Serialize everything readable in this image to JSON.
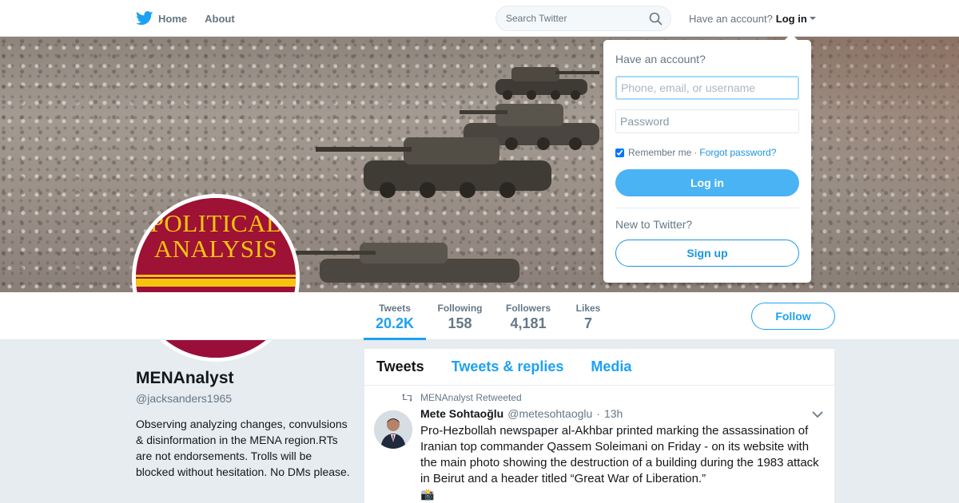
{
  "nav": {
    "home_label": "Home",
    "about_label": "About",
    "search_placeholder": "Search Twitter",
    "have_account": "Have an account?",
    "login_label": "Log in"
  },
  "icons": {
    "logo": "twitter-bird-icon",
    "search": "search-icon",
    "caret": "caret-down-icon",
    "retweet": "retweet-icon",
    "chevron": "chevron-down-icon",
    "camera": "camera-flash-emoji"
  },
  "colors": {
    "accent": "#1da1f2",
    "login_button": "#4ab3f4",
    "avatar_red": "#9e1235",
    "avatar_gold": "#f5c50e"
  },
  "profile": {
    "avatar_line1": "POLITICAL",
    "avatar_line2": "ANALYSIS",
    "name": "MENAnalyst",
    "handle": "@jacksanders1965",
    "bio": "Observing analyzing changes, convulsions & disinformation in the MENA region.RTs are not endorsements. Trolls will be blocked without hesitation. No DMs please."
  },
  "stats": [
    {
      "label": "Tweets",
      "value": "20.2K"
    },
    {
      "label": "Following",
      "value": "158"
    },
    {
      "label": "Followers",
      "value": "4,181"
    },
    {
      "label": "Likes",
      "value": "7"
    }
  ],
  "follow_label": "Follow",
  "timeline": {
    "tabs": [
      "Tweets",
      "Tweets & replies",
      "Media"
    ],
    "active_tab": "Tweets"
  },
  "tweet": {
    "context": "MENAnalyst Retweeted",
    "author_name": "Mete Sohtaoğlu",
    "author_handle": "@metesohtaoglu",
    "separator": "·",
    "time": "13h",
    "text": "Pro-Hezbollah newspaper al-Akhbar printed marking the assassination of Iranian top commander Qassem Soleimani on Friday - on its website with the main photo showing the destruction of a building during the 1983 attack in Beirut and a header titled “Great War of Liberation.”",
    "emoji": "📸"
  },
  "login_dropdown": {
    "title": "Have an account?",
    "username_placeholder": "Phone, email, or username",
    "password_placeholder": "Password",
    "remember_label": "Remember me",
    "remember_checked": true,
    "separator": "·",
    "forgot_label": "Forgot password?",
    "login_button": "Log in",
    "new_label": "New to Twitter?",
    "signup_button": "Sign up"
  }
}
